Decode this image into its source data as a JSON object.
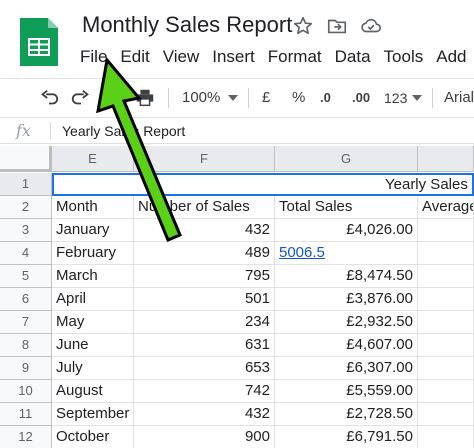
{
  "app": {
    "doc_title": "Monthly Sales Report",
    "menu": [
      "File",
      "Edit",
      "View",
      "Insert",
      "Format",
      "Data",
      "Tools",
      "Add"
    ]
  },
  "toolbar": {
    "zoom": "100%",
    "currency": "£",
    "percent": "%",
    "decimal_decrease": ".0",
    "decimal_increase": ".00",
    "number_format": "123",
    "font": "Arial"
  },
  "formula_bar": {
    "fx_label": "fx",
    "content": "Yearly Sales Report"
  },
  "columns": [
    "E",
    "F",
    "G"
  ],
  "rows": [
    "1",
    "2",
    "3",
    "4",
    "5",
    "6",
    "7",
    "8",
    "9",
    "10",
    "11",
    "12"
  ],
  "sheet": {
    "title_cell": "Yearly Sales R",
    "headers": [
      "Month",
      "Number of Sales",
      "Total Sales",
      "Average"
    ],
    "data": [
      {
        "month": "January",
        "sales": "432",
        "total": "£4,026.00",
        "avg": ""
      },
      {
        "month": "February",
        "sales": "489",
        "total": "5006.5",
        "avg": ""
      },
      {
        "month": "March",
        "sales": "795",
        "total": "£8,474.50",
        "avg": ""
      },
      {
        "month": "April",
        "sales": "501",
        "total": "£3,876.00",
        "avg": ""
      },
      {
        "month": "May",
        "sales": "234",
        "total": "£2,932.50",
        "avg": ""
      },
      {
        "month": "June",
        "sales": "631",
        "total": "£4,607.00",
        "avg": ""
      },
      {
        "month": "July",
        "sales": "653",
        "sales_note": "",
        "total": "£6,307.00",
        "avg": ""
      },
      {
        "month": "August",
        "sales": "742",
        "total": "£5,559.00",
        "avg": ""
      },
      {
        "month": "September",
        "sales": "432",
        "total": "£2,728.50",
        "avg": ""
      },
      {
        "month": "October",
        "sales": "900",
        "total": "£6,791.50",
        "avg": ""
      }
    ]
  },
  "colors": {
    "sheets_green": "#0f9d58",
    "arrow_green": "#5ad117",
    "selection_blue": "#1a73e8",
    "link_blue": "#1155cc"
  },
  "icons": [
    "sheets-logo-icon",
    "star-icon",
    "move-folder-icon",
    "cloud-saved-icon",
    "undo-icon",
    "redo-icon",
    "print-icon",
    "dropdown-arrow-icon",
    "select-all-icon"
  ]
}
